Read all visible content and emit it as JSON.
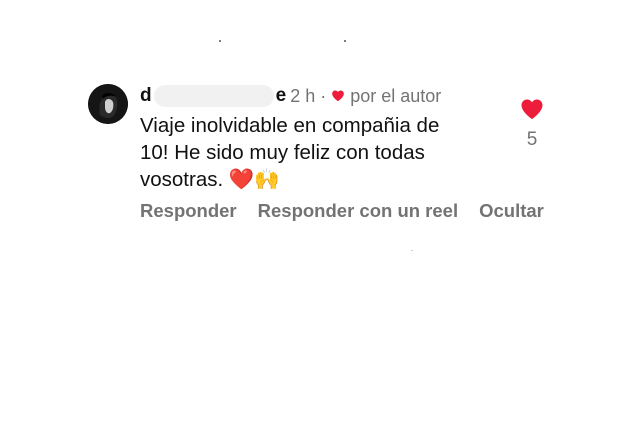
{
  "comment": {
    "username_start": "d",
    "username_end": "e",
    "time": "2 h",
    "separator": "·",
    "liked_by_author_label": "por el autor",
    "text": "Viaje inolvidable en compañia de\n10!  He sido muy feliz con todas\nvosotras. ❤️🙌",
    "actions": {
      "reply": "Responder",
      "reply_reel": "Responder con un reel",
      "hide": "Ocultar"
    },
    "like_count": "5"
  },
  "colors": {
    "heart": "#ed1c3a",
    "secondary_text": "#737373",
    "primary_text": "#111111"
  },
  "icons": {
    "avatar": "profile-avatar",
    "author_like": "heart-icon",
    "like_button": "heart-icon"
  }
}
